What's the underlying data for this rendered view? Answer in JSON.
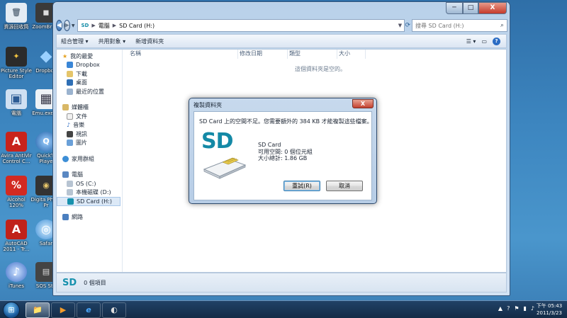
{
  "desktop": {
    "icons": [
      {
        "label": "資源回收筒",
        "glyph": "🗑",
        "color": "#dfe6ee"
      },
      {
        "label": "ZoomBr EX",
        "glyph": "◼",
        "color": "#3a3a3a"
      },
      {
        "label": "Picture Style Editor",
        "glyph": "✦",
        "color": "#2b2b2b"
      },
      {
        "label": "Dropbox",
        "glyph": "◆",
        "color": "#2e7fd8"
      },
      {
        "label": "電腦",
        "glyph": "▣",
        "color": "#5a88c2"
      },
      {
        "label": "Emu.exe 搜",
        "glyph": "▦",
        "color": "#e8eef4"
      },
      {
        "label": "Avira AntiVir Control C...",
        "glyph": "A",
        "color": "#c8231c"
      },
      {
        "label": "QuickTi Playe",
        "glyph": "Q",
        "color": "#2f79c4"
      },
      {
        "label": "Alcohol 120%",
        "glyph": "%",
        "color": "#c42020"
      },
      {
        "label": "Digita Photo Pr",
        "glyph": "◉",
        "color": "#333333"
      },
      {
        "label": "AutoCAD 2011 - Tr...",
        "glyph": "A",
        "color": "#c0221a"
      },
      {
        "label": "Safar",
        "glyph": "◎",
        "color": "#3c8ed6"
      },
      {
        "label": "iTunes",
        "glyph": "♪",
        "color": "#3f6fc8"
      },
      {
        "label": "SOS Stu",
        "glyph": "▤",
        "color": "#444444"
      }
    ]
  },
  "explorer": {
    "caption": {
      "min": "─",
      "max": "□",
      "close": "X"
    },
    "address": {
      "drive_icon": "SD",
      "path1": "電腦",
      "path2": "SD Card (H:)"
    },
    "search_placeholder": "搜尋 SD Card (H:)",
    "toolbar": {
      "organize": "組合管理 ▾",
      "share": "共用對象 ▾",
      "new_folder": "新增資料夾"
    },
    "nav": {
      "favorites": {
        "label": "我的最愛",
        "items": [
          "Dropbox",
          "下載",
          "桌面",
          "最近的位置"
        ]
      },
      "libraries": {
        "label": "媒體櫃",
        "items": [
          "文件",
          "音樂",
          "視訊",
          "圖片"
        ]
      },
      "homegroup": "家用群組",
      "computer": {
        "label": "電腦",
        "items": [
          "OS (C:)",
          "本機磁碟 (D:)",
          "SD Card (H:)"
        ]
      },
      "network": "網路"
    },
    "columns": [
      "名稱",
      "修改日期",
      "類型",
      "大小"
    ],
    "empty_message": "這個資料夾是空的。",
    "details": {
      "logo": "SD",
      "count": "0 個項目"
    }
  },
  "dialog": {
    "title": "複製資料夾",
    "close": "X",
    "message": "SD Card 上的空間不足。您需要額外的 384 KB 才能複製這些檔案。",
    "art": "SD",
    "drive_name": "SD Card",
    "free_space": "可用空間: 0 個位元組",
    "total_size": "大小總計: 1.86 GB",
    "retry": "重試(R)",
    "cancel": "取消"
  },
  "taskbar": {
    "start": "⊞",
    "apps": [
      "📁",
      "▶",
      "e",
      "◐"
    ],
    "tray": [
      "▲",
      "?",
      "⚑",
      "▮",
      "♪"
    ],
    "time": "下午 05:43",
    "date": "2011/3/23"
  }
}
